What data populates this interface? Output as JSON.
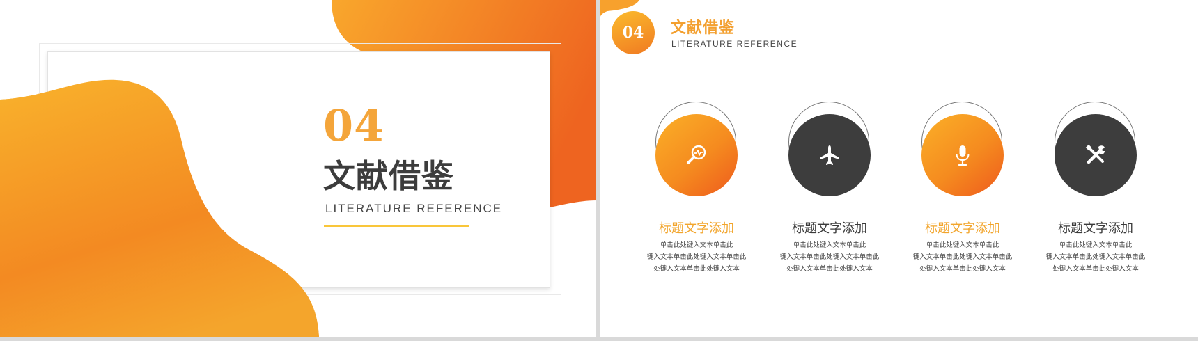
{
  "left_slide": {
    "number": "04",
    "title": "文献借鉴",
    "subtitle": "LITERATURE  REFERENCE"
  },
  "right_slide": {
    "header": {
      "number": "04",
      "title": "文献借鉴",
      "subtitle": "LITERATURE  REFERENCE"
    },
    "items": [
      {
        "icon": "magnifier-heartbeat-icon",
        "style": "orange",
        "title": "标题文字添加",
        "lines": [
          "单击此处键入文本单击此",
          "键入文本单击此处键入文本单击此",
          "处键入文本单击此处键入文本"
        ]
      },
      {
        "icon": "airplane-icon",
        "style": "dark",
        "title": "标题文字添加",
        "lines": [
          "单击此处键入文本单击此",
          "键入文本单击此处键入文本单击此",
          "处键入文本单击此处键入文本"
        ]
      },
      {
        "icon": "microphone-icon",
        "style": "orange",
        "title": "标题文字添加",
        "lines": [
          "单击此处键入文本单击此",
          "键入文本单击此处键入文本单击此",
          "处键入文本单击此处键入文本"
        ]
      },
      {
        "icon": "tools-icon",
        "style": "dark",
        "title": "标题文字添加",
        "lines": [
          "单击此处键入文本单击此",
          "键入文本单击此处键入文本单击此",
          "处键入文本单击此处键入文本"
        ]
      }
    ]
  },
  "colors": {
    "accent_orange": "#f4a53a",
    "deep_orange": "#ee5a1d",
    "dark_gray": "#3d3d3d",
    "underline_yellow": "#f9c63a"
  }
}
